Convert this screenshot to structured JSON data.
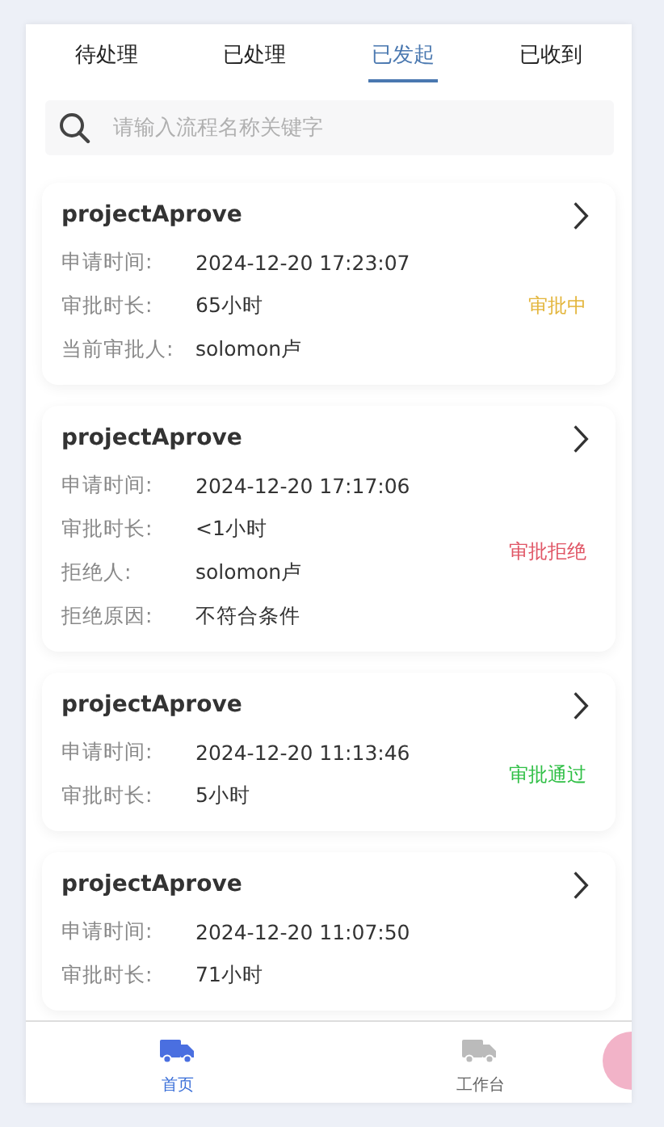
{
  "tabs": [
    {
      "label": "待处理",
      "selected": false
    },
    {
      "label": "已处理",
      "selected": false
    },
    {
      "label": "已发起",
      "selected": true
    },
    {
      "label": "已收到",
      "selected": false
    }
  ],
  "search": {
    "placeholder": "请输入流程名称关键字"
  },
  "cards": [
    {
      "title": "projectAprove",
      "fields": [
        {
          "label": "申请时间:",
          "value": "2024-12-20 17:23:07"
        },
        {
          "label": "审批时长:",
          "value": "65小时"
        },
        {
          "label": "当前审批人:",
          "value": "solomon卢"
        }
      ],
      "status": {
        "kind": "pending",
        "text": "审批中"
      }
    },
    {
      "title": "projectAprove",
      "fields": [
        {
          "label": "申请时间:",
          "value": "2024-12-20 17:17:06"
        },
        {
          "label": "审批时长:",
          "value": "<1小时"
        },
        {
          "label": "拒绝人:",
          "value": "solomon卢"
        },
        {
          "label": "拒绝原因:",
          "value": "不符合条件"
        }
      ],
      "status": {
        "kind": "rejected",
        "text": "审批拒绝"
      }
    },
    {
      "title": "projectAprove",
      "fields": [
        {
          "label": "申请时间:",
          "value": "2024-12-20 11:13:46"
        },
        {
          "label": "审批时长:",
          "value": "5小时"
        }
      ],
      "status": {
        "kind": "approved",
        "text": "审批通过"
      }
    },
    {
      "title": "projectAprove",
      "fields": [
        {
          "label": "申请时间:",
          "value": "2024-12-20 11:07:50"
        },
        {
          "label": "审批时长:",
          "value": "71小时"
        }
      ]
    }
  ],
  "nav": [
    {
      "label": "首页",
      "selected": true
    },
    {
      "label": "工作台",
      "selected": false
    }
  ]
}
